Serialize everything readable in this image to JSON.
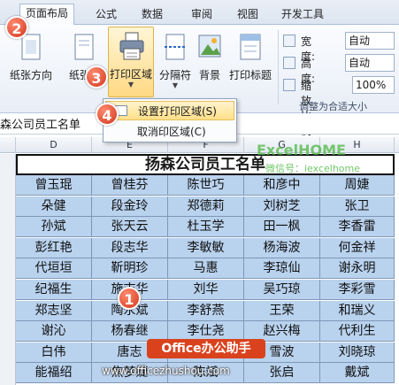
{
  "tabs": [
    "页面布局",
    "公式",
    "数据",
    "审阅",
    "视图",
    "开发工具"
  ],
  "ribbon": {
    "buttons": {
      "orientation": "纸张方向",
      "size": "纸张大",
      "print_area": "打印区域",
      "breaks": "分隔符",
      "background": "背景",
      "print_titles": "打印标题"
    },
    "scale": {
      "width_label": "宽度:",
      "width_value": "自动",
      "height_label": "高度:",
      "height_value": "自动",
      "zoom_label": "缩放比例:",
      "zoom_value": "100%",
      "group_label": "调整为合适大小"
    }
  },
  "dropdown": {
    "set_area": "设置打印区域(S)",
    "clear_area": "取消印区域(C)"
  },
  "namebox": "森公司员工名单",
  "columns": [
    "D",
    "E",
    "F",
    "G",
    "H"
  ],
  "sheet": {
    "title": "扬森公司员工名单",
    "rows": [
      [
        "曾玉琨",
        "曾桂芬",
        "陈世巧",
        "和彦中",
        "周婕"
      ],
      [
        "朵健",
        "段金玲",
        "郑德莉",
        "刘树芝",
        "张卫"
      ],
      [
        "孙斌",
        "张天云",
        "杜玉学",
        "田一枫",
        "李香雷"
      ],
      [
        "彭红艳",
        "段志华",
        "李敏敏",
        "杨海波",
        "何金祥"
      ],
      [
        "代垣垣",
        "靳明珍",
        "马惠",
        "李琼仙",
        "谢永明"
      ],
      [
        "纪福生",
        "施志华",
        "刘华",
        "吴巧琼",
        "李彩雪"
      ],
      [
        "郑志坚",
        "陶永斌",
        "李舒燕",
        "王荣",
        "和瑞义"
      ],
      [
        "谢沁",
        "杨春继",
        "李仕尧",
        "赵兴梅",
        "代利生"
      ],
      [
        "白伟",
        "唐志",
        "",
        "雪波",
        "刘晓琼"
      ],
      [
        "能福绍",
        "焦梦婕",
        "陈斌",
        "张启",
        "戴斌"
      ]
    ]
  },
  "badges": [
    "1",
    "2",
    "3",
    "4"
  ],
  "watermark": {
    "brand": "Office办公助手",
    "url": "www.officezhushou.com",
    "logo": "ExcelHOME",
    "logo_sub": "微信号：iexcelhome"
  }
}
